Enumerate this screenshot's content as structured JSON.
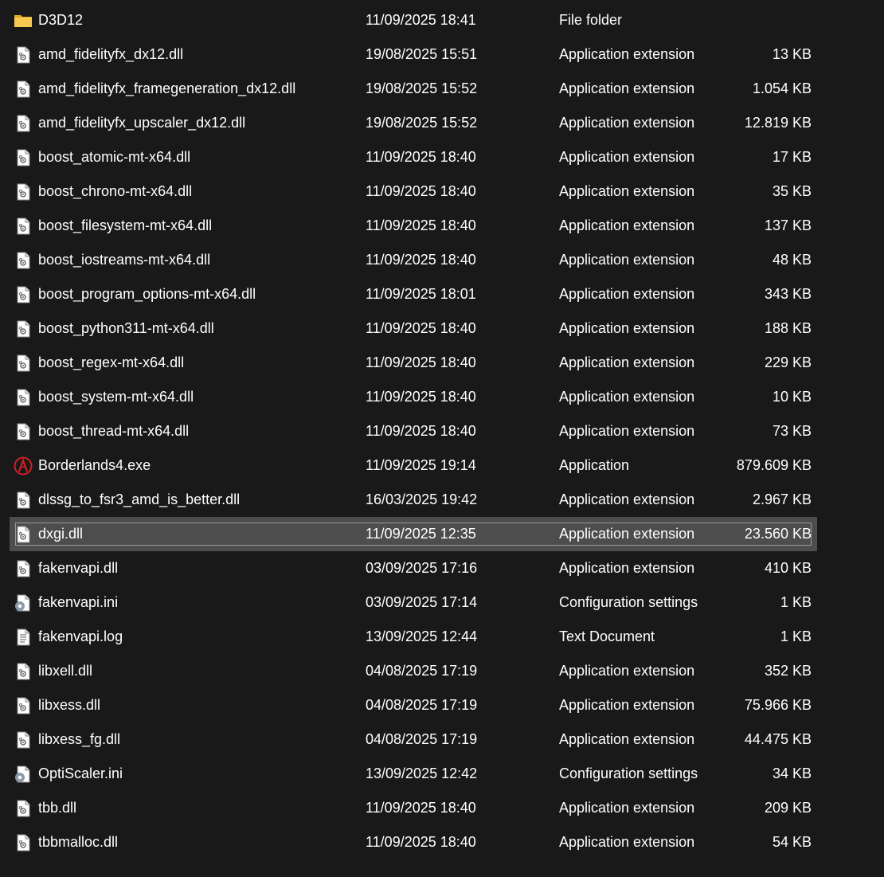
{
  "files": [
    {
      "name": "D3D12",
      "date": "11/09/2025 18:41",
      "type": "File folder",
      "size": "",
      "icon": "folder-icon",
      "selected": false
    },
    {
      "name": "amd_fidelityfx_dx12.dll",
      "date": "19/08/2025 15:51",
      "type": "Application extension",
      "size": "13 KB",
      "icon": "dll-file-icon",
      "selected": false
    },
    {
      "name": "amd_fidelityfx_framegeneration_dx12.dll",
      "date": "19/08/2025 15:52",
      "type": "Application extension",
      "size": "1.054 KB",
      "icon": "dll-file-icon",
      "selected": false
    },
    {
      "name": "amd_fidelityfx_upscaler_dx12.dll",
      "date": "19/08/2025 15:52",
      "type": "Application extension",
      "size": "12.819 KB",
      "icon": "dll-file-icon",
      "selected": false
    },
    {
      "name": "boost_atomic-mt-x64.dll",
      "date": "11/09/2025 18:40",
      "type": "Application extension",
      "size": "17 KB",
      "icon": "dll-file-icon",
      "selected": false
    },
    {
      "name": "boost_chrono-mt-x64.dll",
      "date": "11/09/2025 18:40",
      "type": "Application extension",
      "size": "35 KB",
      "icon": "dll-file-icon",
      "selected": false
    },
    {
      "name": "boost_filesystem-mt-x64.dll",
      "date": "11/09/2025 18:40",
      "type": "Application extension",
      "size": "137 KB",
      "icon": "dll-file-icon",
      "selected": false
    },
    {
      "name": "boost_iostreams-mt-x64.dll",
      "date": "11/09/2025 18:40",
      "type": "Application extension",
      "size": "48 KB",
      "icon": "dll-file-icon",
      "selected": false
    },
    {
      "name": "boost_program_options-mt-x64.dll",
      "date": "11/09/2025 18:01",
      "type": "Application extension",
      "size": "343 KB",
      "icon": "dll-file-icon",
      "selected": false
    },
    {
      "name": "boost_python311-mt-x64.dll",
      "date": "11/09/2025 18:40",
      "type": "Application extension",
      "size": "188 KB",
      "icon": "dll-file-icon",
      "selected": false
    },
    {
      "name": "boost_regex-mt-x64.dll",
      "date": "11/09/2025 18:40",
      "type": "Application extension",
      "size": "229 KB",
      "icon": "dll-file-icon",
      "selected": false
    },
    {
      "name": "boost_system-mt-x64.dll",
      "date": "11/09/2025 18:40",
      "type": "Application extension",
      "size": "10 KB",
      "icon": "dll-file-icon",
      "selected": false
    },
    {
      "name": "boost_thread-mt-x64.dll",
      "date": "11/09/2025 18:40",
      "type": "Application extension",
      "size": "73 KB",
      "icon": "dll-file-icon",
      "selected": false
    },
    {
      "name": "Borderlands4.exe",
      "date": "11/09/2025 19:14",
      "type": "Application",
      "size": "879.609 KB",
      "icon": "borderlands-app-icon",
      "selected": false
    },
    {
      "name": "dlssg_to_fsr3_amd_is_better.dll",
      "date": "16/03/2025 19:42",
      "type": "Application extension",
      "size": "2.967 KB",
      "icon": "dll-file-icon",
      "selected": false
    },
    {
      "name": "dxgi.dll",
      "date": "11/09/2025 12:35",
      "type": "Application extension",
      "size": "23.560 KB",
      "icon": "dll-file-icon",
      "selected": true
    },
    {
      "name": "fakenvapi.dll",
      "date": "03/09/2025 17:16",
      "type": "Application extension",
      "size": "410 KB",
      "icon": "dll-file-icon",
      "selected": false
    },
    {
      "name": "fakenvapi.ini",
      "date": "03/09/2025 17:14",
      "type": "Configuration settings",
      "size": "1 KB",
      "icon": "config-file-icon",
      "selected": false
    },
    {
      "name": "fakenvapi.log",
      "date": "13/09/2025 12:44",
      "type": "Text Document",
      "size": "1 KB",
      "icon": "text-file-icon",
      "selected": false
    },
    {
      "name": "libxell.dll",
      "date": "04/08/2025 17:19",
      "type": "Application extension",
      "size": "352 KB",
      "icon": "dll-file-icon",
      "selected": false
    },
    {
      "name": "libxess.dll",
      "date": "04/08/2025 17:19",
      "type": "Application extension",
      "size": "75.966 KB",
      "icon": "dll-file-icon",
      "selected": false
    },
    {
      "name": "libxess_fg.dll",
      "date": "04/08/2025 17:19",
      "type": "Application extension",
      "size": "44.475 KB",
      "icon": "dll-file-icon",
      "selected": false
    },
    {
      "name": "OptiScaler.ini",
      "date": "13/09/2025 12:42",
      "type": "Configuration settings",
      "size": "34 KB",
      "icon": "config-file-icon",
      "selected": false
    },
    {
      "name": "tbb.dll",
      "date": "11/09/2025 18:40",
      "type": "Application extension",
      "size": "209 KB",
      "icon": "dll-file-icon",
      "selected": false
    },
    {
      "name": "tbbmalloc.dll",
      "date": "11/09/2025 18:40",
      "type": "Application extension",
      "size": "54 KB",
      "icon": "dll-file-icon",
      "selected": false
    }
  ],
  "colors": {
    "background": "#191919",
    "text": "#ffffff",
    "selected_row": "#4d4d4d",
    "folder": "#f4c34e",
    "app_icon": "#d01f25"
  }
}
